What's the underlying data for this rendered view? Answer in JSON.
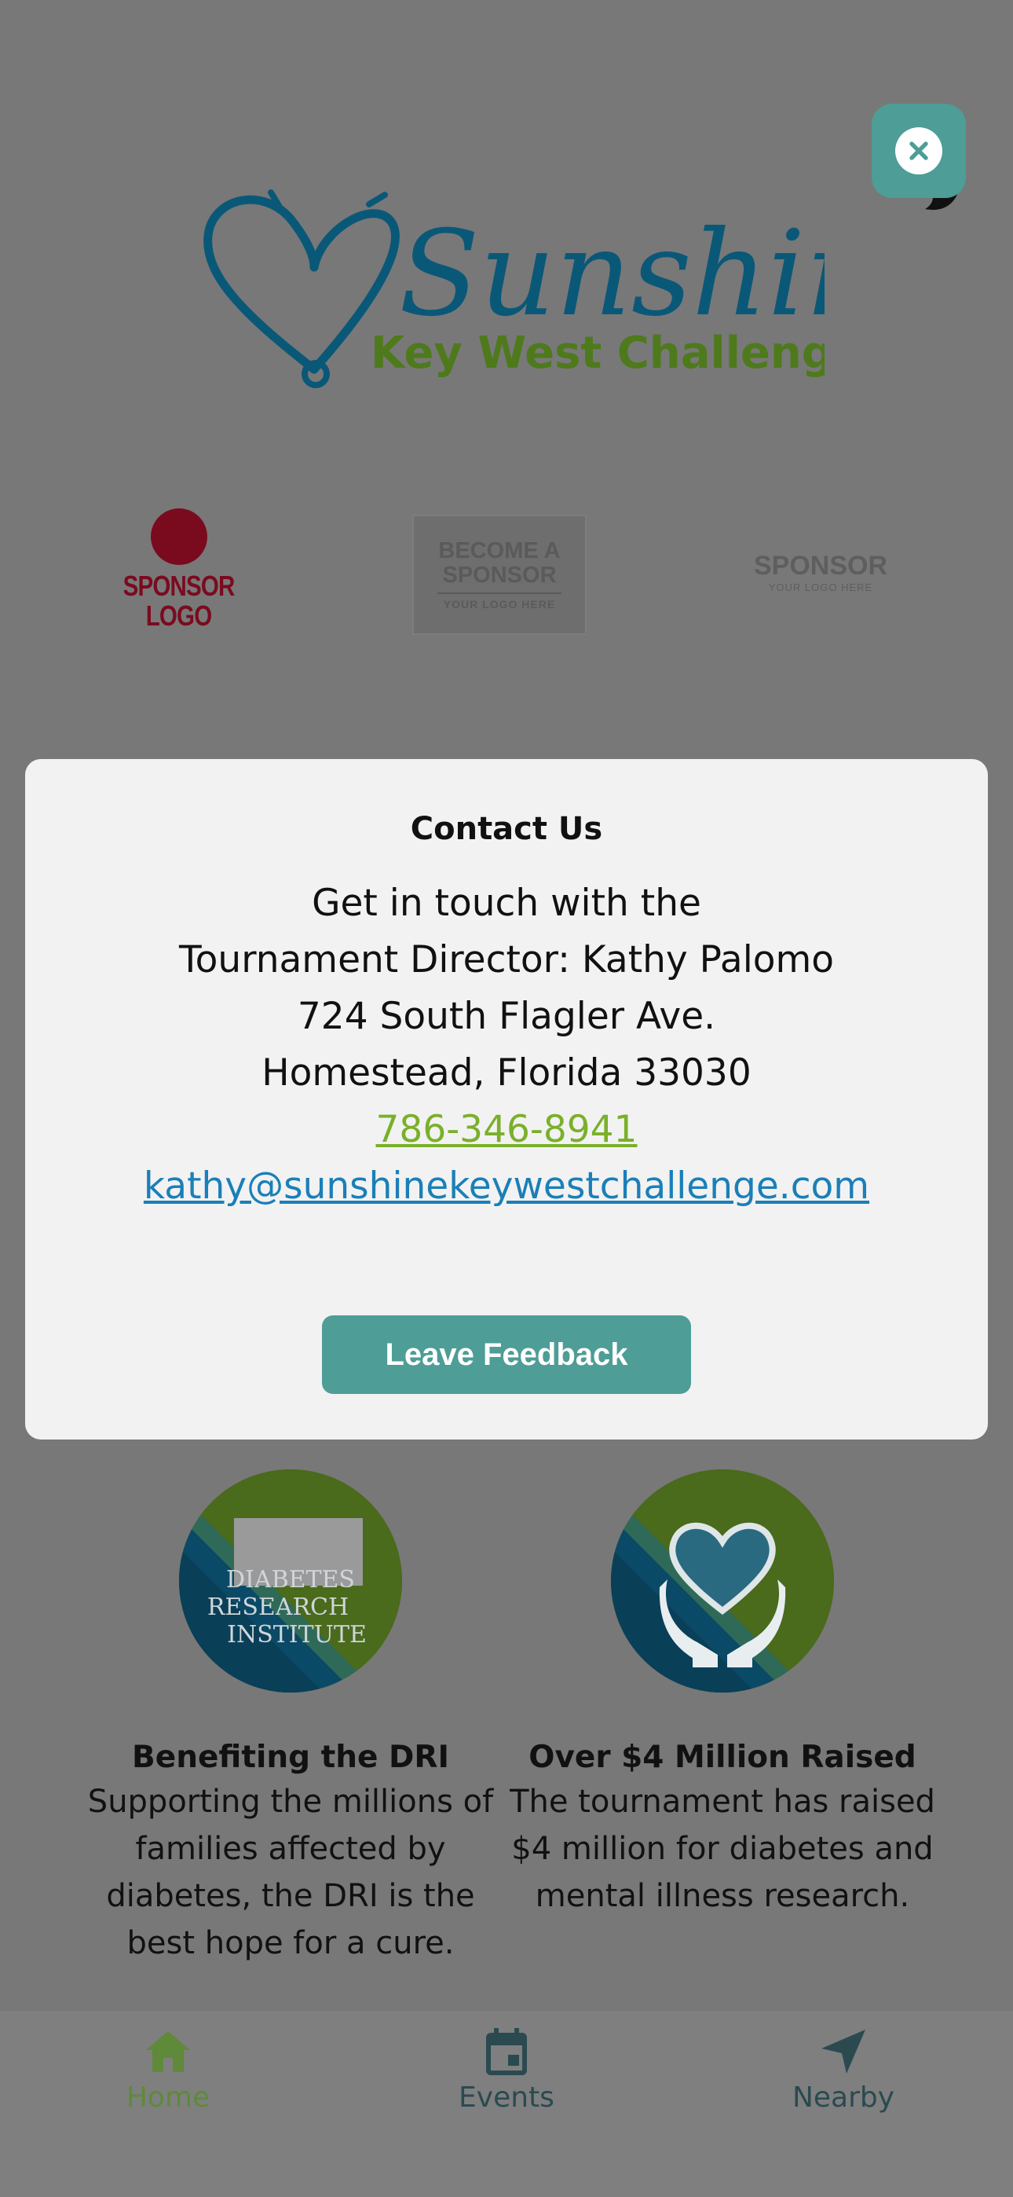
{
  "header": {
    "logo": {
      "title": "Sunshine",
      "subtitle": "Key West Challenge",
      "icon": "heart-fishhook-icon"
    },
    "close_icon": "close-icon"
  },
  "sponsors": [
    {
      "lines": [
        "SPONSOR",
        "LOGO"
      ],
      "color": "#7a0b1f"
    },
    {
      "lines": [
        "BECOME A",
        "SPONSOR"
      ],
      "small": "YOUR LOGO HERE"
    },
    {
      "main": "SPONSOR",
      "small": "YOUR LOGO HERE"
    }
  ],
  "modal": {
    "title": "Contact Us",
    "lines": [
      "Get in touch with the",
      "Tournament Director: Kathy Palomo",
      "724 South Flagler Ave.",
      "Homestead, Florida 33030"
    ],
    "phone": "786-346-8941",
    "email": "kathy@sunshinekeywestchallenge.com",
    "feedback_label": "Leave Feedback"
  },
  "features": [
    {
      "badge_text": [
        "DIABETES",
        "RESEARCH",
        "INSTITUTE"
      ],
      "title": "Benefiting the DRI",
      "body": "Supporting the millions of families affected by diabetes, the DRI is the best hope for a cure."
    },
    {
      "badge_icon": "heart-in-hands-icon",
      "title": "Over $4 Million Raised",
      "body": "The tournament has raised $4 million for diabetes and mental illness research."
    }
  ],
  "tabbar": {
    "items": [
      {
        "label": "Home",
        "icon": "home-icon",
        "active": true
      },
      {
        "label": "Events",
        "icon": "calendar-icon",
        "active": false
      },
      {
        "label": "Nearby",
        "icon": "location-arrow-icon",
        "active": false
      }
    ]
  },
  "colors": {
    "accent": "#4e9d97",
    "logo_blue": "#0a5878",
    "logo_green": "#4e7a1c",
    "phone_link": "#7ab02a",
    "email_link": "#1a7fb8",
    "overlay": "#787878"
  }
}
